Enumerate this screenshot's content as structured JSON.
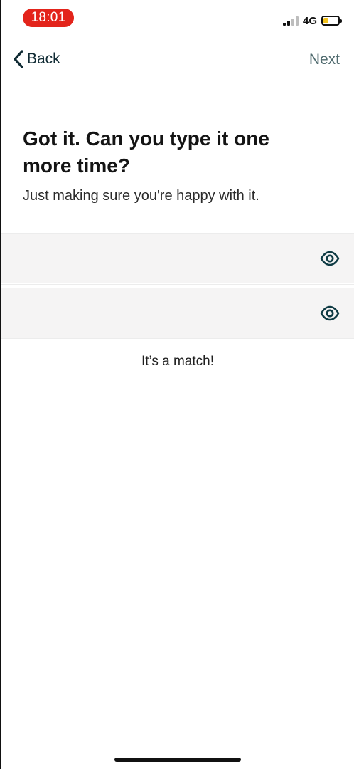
{
  "status_bar": {
    "time": "18:01",
    "network": "4G",
    "battery_level": 0.35,
    "signal_bars_on": 2,
    "signal_bars_total": 4
  },
  "nav": {
    "back_label": "Back",
    "next_label": "Next"
  },
  "content": {
    "heading": "Got it. Can you type it one more time?",
    "subheading": "Just making sure you're happy with it.",
    "match_text": "It’s a match!"
  },
  "icons": {
    "back": "chevron-left-icon",
    "eye": "eye-icon"
  },
  "colors": {
    "accent": "#0f3b44",
    "time_pill": "#e3241b",
    "field_bg": "#f5f4f4",
    "battery": "#f2c21b"
  }
}
